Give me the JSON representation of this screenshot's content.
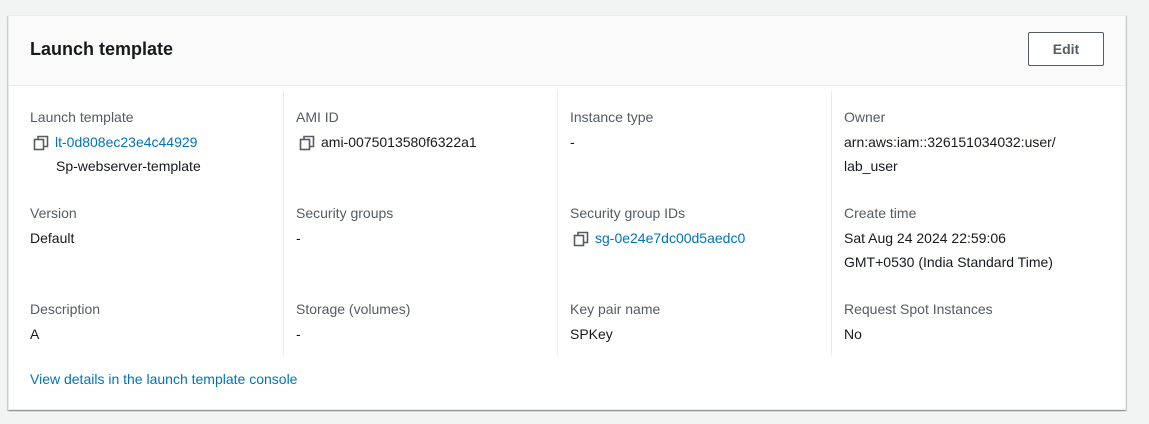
{
  "panel": {
    "title": "Launch template",
    "edit_label": "Edit"
  },
  "fields": {
    "launch_template": {
      "label": "Launch template",
      "id": "lt-0d808ec23e4c44929",
      "name": "Sp-webserver-template"
    },
    "ami_id": {
      "label": "AMI ID",
      "value": "ami-0075013580f6322a1"
    },
    "instance_type": {
      "label": "Instance type",
      "value": "-"
    },
    "owner": {
      "label": "Owner",
      "line1": "arn:aws:iam::326151034032:user/",
      "line2": "lab_user"
    },
    "version": {
      "label": "Version",
      "value": "Default"
    },
    "security_groups": {
      "label": "Security groups",
      "value": "-"
    },
    "security_group_ids": {
      "label": "Security group IDs",
      "value": "sg-0e24e7dc00d5aedc0"
    },
    "create_time": {
      "label": "Create time",
      "line1": "Sat Aug 24 2024 22:59:06",
      "line2": "GMT+0530 (India Standard Time)"
    },
    "description": {
      "label": "Description",
      "value": "A"
    },
    "storage": {
      "label": "Storage (volumes)",
      "value": "-"
    },
    "key_pair": {
      "label": "Key pair name",
      "value": "SPKey"
    },
    "spot": {
      "label": "Request Spot Instances",
      "value": "No"
    }
  },
  "footer": {
    "link_label": "View details in the launch template console"
  },
  "icons": {
    "copy": "copy-icon"
  },
  "colors": {
    "link": "#0073bb",
    "label": "#545b64",
    "text": "#16191f",
    "header_bg": "#fafafa",
    "page_bg": "#f2f3f3"
  }
}
